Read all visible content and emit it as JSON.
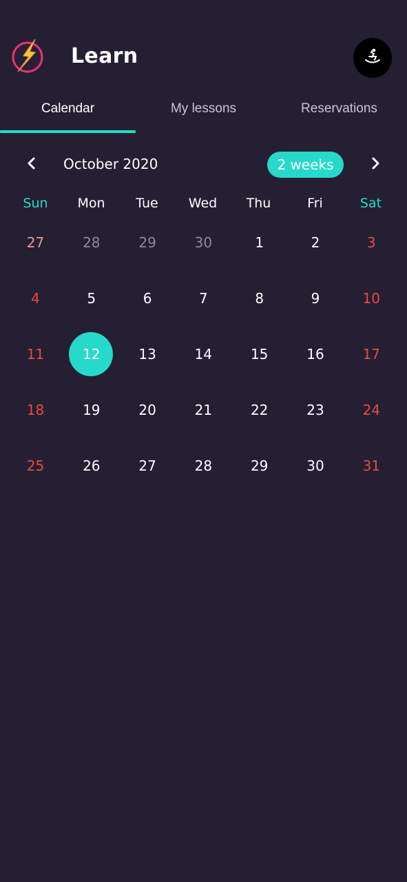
{
  "header": {
    "title": "Learn"
  },
  "tabs": [
    {
      "label": "Calendar",
      "active": true
    },
    {
      "label": "My lessons",
      "active": false
    },
    {
      "label": "Reservations",
      "active": false
    }
  ],
  "calendar": {
    "month_label": "October 2020",
    "range_label": "2 weeks",
    "weekdays": [
      "Sun",
      "Mon",
      "Tue",
      "Wed",
      "Thu",
      "Fri",
      "Sat"
    ],
    "selected_day": "12",
    "weeks": [
      [
        {
          "d": "27",
          "muted": true
        },
        {
          "d": "28",
          "muted": true
        },
        {
          "d": "29",
          "muted": true
        },
        {
          "d": "30",
          "muted": true
        },
        {
          "d": "1",
          "muted": false
        },
        {
          "d": "2",
          "muted": false
        },
        {
          "d": "3",
          "muted": false
        }
      ],
      [
        {
          "d": "4"
        },
        {
          "d": "5"
        },
        {
          "d": "6"
        },
        {
          "d": "7"
        },
        {
          "d": "8"
        },
        {
          "d": "9"
        },
        {
          "d": "10"
        }
      ],
      [
        {
          "d": "11"
        },
        {
          "d": "12"
        },
        {
          "d": "13"
        },
        {
          "d": "14"
        },
        {
          "d": "15"
        },
        {
          "d": "16"
        },
        {
          "d": "17"
        }
      ],
      [
        {
          "d": "18"
        },
        {
          "d": "19"
        },
        {
          "d": "20"
        },
        {
          "d": "21"
        },
        {
          "d": "22"
        },
        {
          "d": "23"
        },
        {
          "d": "24"
        }
      ],
      [
        {
          "d": "25"
        },
        {
          "d": "26"
        },
        {
          "d": "27"
        },
        {
          "d": "28"
        },
        {
          "d": "29"
        },
        {
          "d": "30"
        },
        {
          "d": "31"
        }
      ]
    ]
  },
  "icons": {
    "logo": "lightning-bolt-icon",
    "profile": "rocking-horse-icon",
    "prev": "chevron-left-icon",
    "next": "chevron-right-icon"
  },
  "colors": {
    "background": "#241f32",
    "accent": "#27d9cb",
    "weekend_red": "#ec4a42",
    "muted": "#8e8a99"
  }
}
